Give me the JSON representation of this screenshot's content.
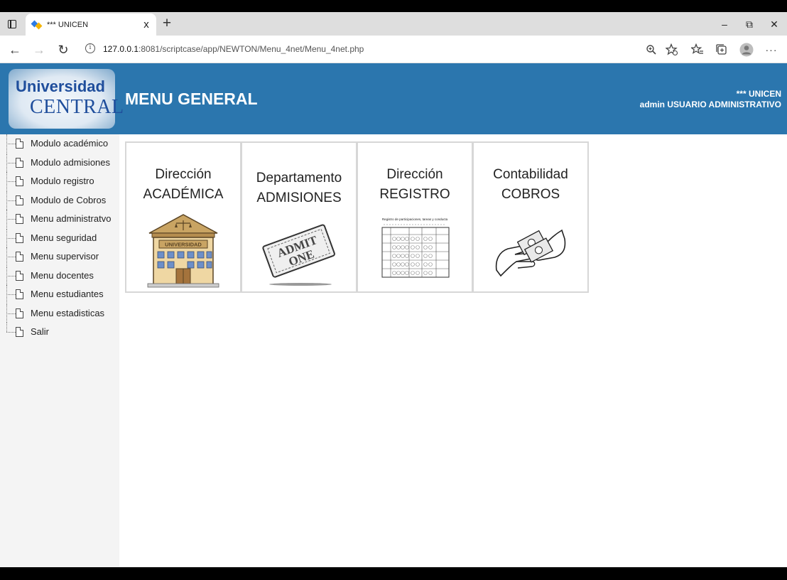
{
  "browser": {
    "tab_title": "*** UNICEN",
    "tab_close": "x",
    "new_tab": "+",
    "url_host": "127.0.0.1",
    "url_rest": ":8081/scriptcase/app/NEWTON/Menu_4net/Menu_4net.php",
    "window_controls": {
      "minimize": "–",
      "restore": "⧉",
      "close": "✕"
    }
  },
  "header": {
    "logo_line1": "Universidad",
    "logo_line2": "CENTRAL",
    "title": "MENU GENERAL",
    "org": "*** UNICEN",
    "user": "admin USUARIO ADMINISTRATIVO",
    "colors": {
      "bar": "#2b76ae"
    }
  },
  "sidebar": {
    "items": [
      {
        "label": "Modulo académico"
      },
      {
        "label": "Modulo admisiones"
      },
      {
        "label": "Modulo registro"
      },
      {
        "label": "Modulo de Cobros"
      },
      {
        "label": "Menu administratvo"
      },
      {
        "label": "Menu seguridad"
      },
      {
        "label": "Menu supervisor"
      },
      {
        "label": "Menu docentes"
      },
      {
        "label": "Menu estudiantes"
      },
      {
        "label": "Menu estadisticas"
      },
      {
        "label": "Salir"
      }
    ]
  },
  "cards": [
    {
      "line1": "Dirección",
      "line2": "ACADÉMICA",
      "icon": "university-building-icon",
      "sign": "UNIVERSIDAD"
    },
    {
      "line1": "Departamento",
      "line2": "ADMISIONES",
      "icon": "admit-one-ticket-icon",
      "ticket1": "ADMIT",
      "ticket2": "ONE"
    },
    {
      "line1": "Dirección",
      "line2": "REGISTRO",
      "icon": "grade-register-sheet-icon",
      "sheet_title": "Registro de participaciones, tareas y conducta"
    },
    {
      "line1": "Contabilidad",
      "line2": "COBROS",
      "icon": "money-hands-icon"
    }
  ]
}
